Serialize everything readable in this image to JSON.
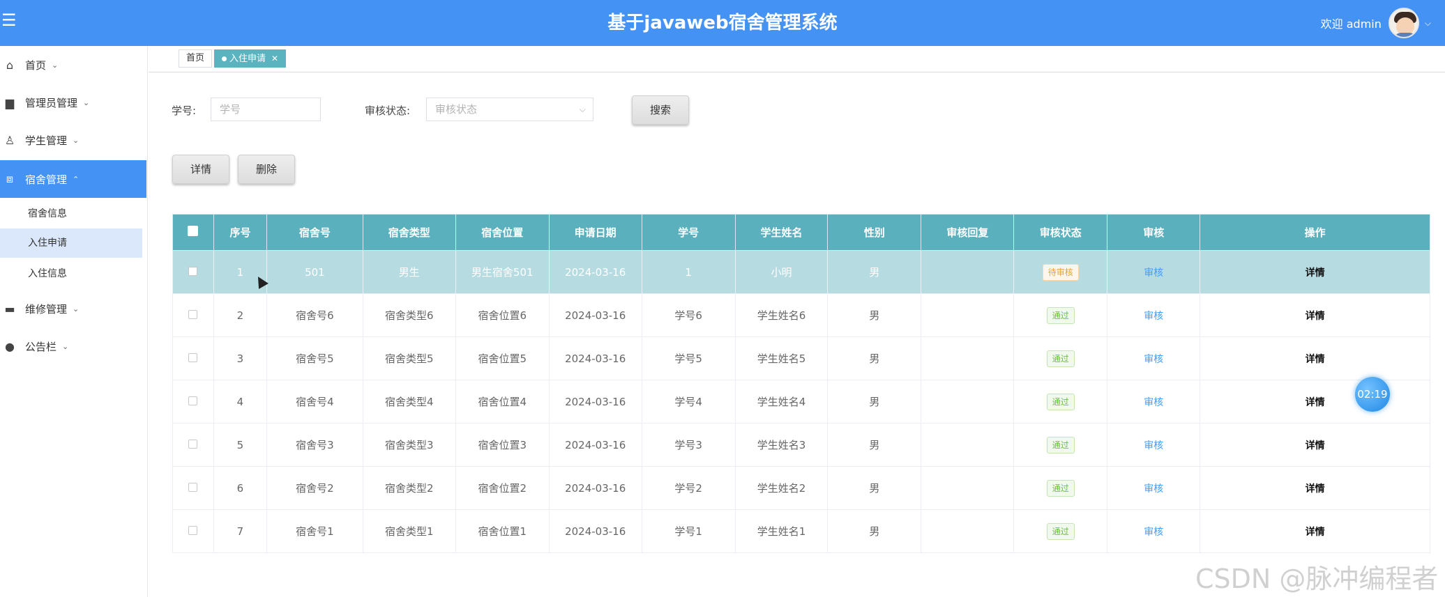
{
  "header": {
    "title": "基于javaweb宿舍管理系统",
    "welcome": "欢迎 admin",
    "caret": "⌵"
  },
  "sidebar": {
    "items": [
      {
        "label": "首页",
        "icon": "home-icon"
      },
      {
        "label": "管理员管理",
        "icon": "briefcase-icon"
      },
      {
        "label": "学生管理",
        "icon": "user-icon"
      },
      {
        "label": "宿舍管理",
        "icon": "chip-icon"
      },
      {
        "label": "维修管理",
        "icon": "wallet-icon"
      },
      {
        "label": "公告栏",
        "icon": "more-icon"
      }
    ],
    "dorm_sub": [
      "宿舍信息",
      "入住申请",
      "入住信息"
    ]
  },
  "tabs": [
    {
      "label": "首页"
    },
    {
      "label": "入住申请"
    }
  ],
  "search": {
    "student_label": "学号:",
    "student_placeholder": "学号",
    "status_label": "审核状态:",
    "status_placeholder": "审核状态",
    "search_button": "搜索"
  },
  "actions": {
    "detail_button": "详情",
    "delete_button": "删除"
  },
  "table": {
    "headers": [
      "序号",
      "宿舍号",
      "宿舍类型",
      "宿舍位置",
      "申请日期",
      "学号",
      "学生姓名",
      "性别",
      "审核回复",
      "审核状态",
      "审核",
      "操作"
    ],
    "rows": [
      {
        "no": "1",
        "room": "501",
        "type": "男生",
        "location": "男生宿舍501",
        "date": "2024-03-16",
        "sid": "1",
        "name": "小明",
        "gender": "男",
        "reply": "",
        "status": "待审核",
        "audit": "审核",
        "op": "详情"
      },
      {
        "no": "2",
        "room": "宿舍号6",
        "type": "宿舍类型6",
        "location": "宿舍位置6",
        "date": "2024-03-16",
        "sid": "学号6",
        "name": "学生姓名6",
        "gender": "男",
        "reply": "",
        "status": "通过",
        "audit": "审核",
        "op": "详情"
      },
      {
        "no": "3",
        "room": "宿舍号5",
        "type": "宿舍类型5",
        "location": "宿舍位置5",
        "date": "2024-03-16",
        "sid": "学号5",
        "name": "学生姓名5",
        "gender": "男",
        "reply": "",
        "status": "通过",
        "audit": "审核",
        "op": "详情"
      },
      {
        "no": "4",
        "room": "宿舍号4",
        "type": "宿舍类型4",
        "location": "宿舍位置4",
        "date": "2024-03-16",
        "sid": "学号4",
        "name": "学生姓名4",
        "gender": "男",
        "reply": "",
        "status": "通过",
        "audit": "审核",
        "op": "详情"
      },
      {
        "no": "5",
        "room": "宿舍号3",
        "type": "宿舍类型3",
        "location": "宿舍位置3",
        "date": "2024-03-16",
        "sid": "学号3",
        "name": "学生姓名3",
        "gender": "男",
        "reply": "",
        "status": "通过",
        "audit": "审核",
        "op": "详情"
      },
      {
        "no": "6",
        "room": "宿舍号2",
        "type": "宿舍类型2",
        "location": "宿舍位置2",
        "date": "2024-03-16",
        "sid": "学号2",
        "name": "学生姓名2",
        "gender": "男",
        "reply": "",
        "status": "通过",
        "audit": "审核",
        "op": "详情"
      },
      {
        "no": "7",
        "room": "宿舍号1",
        "type": "宿舍类型1",
        "location": "宿舍位置1",
        "date": "2024-03-16",
        "sid": "学号1",
        "name": "学生姓名1",
        "gender": "男",
        "reply": "",
        "status": "通过",
        "audit": "审核",
        "op": "详情"
      }
    ]
  },
  "timer": "02:19",
  "watermark": "CSDN @脉冲编程者",
  "colors": {
    "primary": "#4592f5",
    "table_header": "#5bb0bd",
    "highlight_row": "#b6dbe1",
    "pass": "#67c23a",
    "pending": "#e6a23c",
    "link": "#409eff"
  }
}
